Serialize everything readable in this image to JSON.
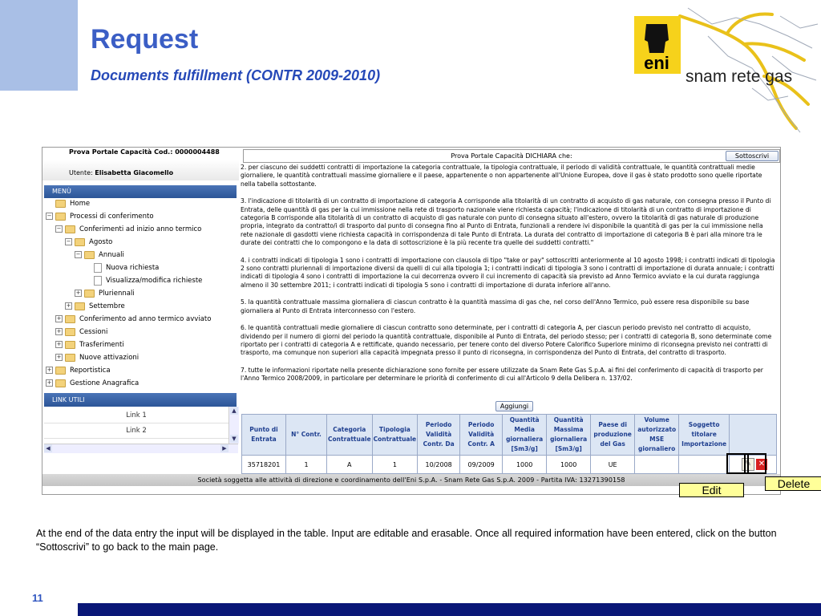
{
  "slide": {
    "title": "Request",
    "subtitle": "Documents fulfillment (CONTR 2009-2010)",
    "page_number": "11",
    "caption": "At the end of the data entry the input will be displayed in the table. Input are editable and erasable. Once all required information have been entered, click on the button “Sottoscrivi” to go back to the main page.",
    "logos": {
      "eni": "eni",
      "snam": "snam rete gas"
    }
  },
  "portal": {
    "code_label": "Prova Portale Capacità Cod.:",
    "code_value": "0000004488",
    "user_label": "Utente:",
    "user_value": "Elisabetta Giacomello",
    "menu_title": "MENÙ",
    "links_title": "LINK UTILI",
    "links": [
      "Link 1",
      "Link 2"
    ],
    "tree": [
      {
        "label": "Home",
        "level": 0,
        "icon": "folder",
        "toggle": ""
      },
      {
        "label": "Processi di conferimento",
        "level": 0,
        "icon": "folder",
        "toggle": "−"
      },
      {
        "label": "Conferimenti ad inizio anno termico",
        "level": 1,
        "icon": "folder",
        "toggle": "−"
      },
      {
        "label": "Agosto",
        "level": 2,
        "icon": "folder",
        "toggle": "−"
      },
      {
        "label": "Annuali",
        "level": 3,
        "icon": "folder",
        "toggle": "−"
      },
      {
        "label": "Nuova richiesta",
        "level": 4,
        "icon": "doc",
        "toggle": ""
      },
      {
        "label": "Visualizza/modifica richieste",
        "level": 4,
        "icon": "doc",
        "toggle": ""
      },
      {
        "label": "Pluriennali",
        "level": 3,
        "icon": "folder",
        "toggle": "+"
      },
      {
        "label": "Settembre",
        "level": 2,
        "icon": "folder",
        "toggle": "+"
      },
      {
        "label": "Conferimento ad anno termico avviato",
        "level": 1,
        "icon": "folder",
        "toggle": "+"
      },
      {
        "label": "Cessioni",
        "level": 1,
        "icon": "folder",
        "toggle": "+"
      },
      {
        "label": "Trasferimenti",
        "level": 1,
        "icon": "folder",
        "toggle": "+"
      },
      {
        "label": "Nuove attivazioni",
        "level": 1,
        "icon": "folder",
        "toggle": "+"
      },
      {
        "label": "Reportistica",
        "level": 0,
        "icon": "folder",
        "toggle": "+"
      },
      {
        "label": "Gestione Anagrafica",
        "level": 0,
        "icon": "folder",
        "toggle": "+"
      }
    ],
    "declaration_title": "Prova Portale Capacità DICHIARA che:",
    "sottoscrivi_label": "Sottoscrivi",
    "declaration_paragraphs": [
      "2. per ciascuno dei suddetti contratti di importazione la categoria contrattuale, la tipologia contrattuale, il periodo di validità contrattuale, le quantità contrattuali medie giornaliere, le quantità contrattuali massime giornaliere e il paese, appartenente o non appartenente all'Unione Europea, dove il gas è stato prodotto sono quelle riportate nella tabella sottostante.",
      "3. l'indicazione di titolarità di un contratto di importazione di categoria A corrisponde alla titolarità di un contratto di acquisto di gas naturale, con consegna presso il Punto di Entrata, delle quantità di gas per la cui immissione nella rete di trasporto nazionale viene richiesta capacità; l'indicazione di titolarità di un contratto di importazione di categoria B corrisponde alla titolarità di un contratto di acquisto di gas naturale con punto di consegna situato all'estero, ovvero la titolarità di gas naturale di produzione propria, integrato da contratto/i di trasporto dal punto di consegna fino al Punto di Entrata, funzionali a rendere ivi disponibile la quantità di gas per la cui immissione nella rete nazionale di gasdotti viene richiesta capacità in corrispondenza di tale Punto di Entrata. La durata del contratto di importazione di categoria B è pari alla minore tra le durate dei contratti che lo compongono e la data di sottoscrizione è la più recente tra quelle dei suddetti contratti.\"",
      "4. i contratti indicati di tipologia 1 sono i contratti di importazione con clausola di tipo \"take or pay\" sottoscritti anteriormente al 10 agosto 1998; i contratti indicati di tipologia 2 sono contratti pluriennali di importazione diversi da quelli di cui alla tipologia 1; i contratti indicati di tipologia 3 sono i contratti di importazione di durata annuale; i contratti indicati di tipologia 4 sono i contratti di importazione la cui decorrenza ovvero il cui incremento di capacità sia previsto ad Anno Termico avviato e la cui durata raggiunga almeno il 30 settembre 2011; i contratti indicati di tipologia 5 sono i contratti di importazione di durata inferiore all'anno.",
      "5. la quantità contrattuale massima giornaliera di ciascun contratto è la quantità massima di gas che, nel corso dell'Anno Termico, può essere resa disponibile su base giornaliera al Punto di Entrata interconnesso con l'estero.",
      "6. le quantità contrattuali medie giornaliere di ciascun contratto sono determinate, per i contratti di categoria A, per ciascun periodo previsto nel contratto di acquisto, dividendo per il numero di giorni del periodo la quantità contrattuale, disponibile al Punto di Entrata, del periodo stesso; per i contratti di categoria B, sono determinate come riportato per i contratti di categoria A e rettificate, quando necessario, per tenere conto del diverso Potere Calorifico Superiore minimo di riconsegna previsto nei contratti di trasporto, ma comunque non superiori alla capacità impegnata presso il punto di riconsegna, in corrispondenza del Punto di Entrata, del contratto di trasporto.",
      "7. tutte le informazioni riportate nella presente dichiarazione sono fornite per essere utilizzate da Snam Rete Gas S.p.A. ai fini del conferimento di capacità di trasporto per l'Anno Termico 2008/2009, in particolare per determinare le priorità di conferimento di cui all'Articolo 9 della Delibera n. 137/02."
    ],
    "aggiungi_label": "Aggiungi",
    "table": {
      "headers": [
        "Punto di Entrata",
        "N° Contr.",
        "Categoria Contrattuale",
        "Tipologia Contrattuale",
        "Periodo Validità Contr. Da",
        "Periodo Validità Contr. A",
        "Quantità Media giornaliera [Sm3/g]",
        "Quantità Massima giornaliera [Sm3/g]",
        "Paese di produzione del Gas",
        "Volume autorizzato MSE giornaliero",
        "Soggetto titolare Importazione",
        ""
      ],
      "rows": [
        [
          "35718201",
          "1",
          "A",
          "1",
          "10/2008",
          "09/2009",
          "1000",
          "1000",
          "UE",
          "",
          ""
        ]
      ]
    },
    "footer_text": "Società soggetta alle attività di direzione e coordinamento dell'Eni S.p.A. - Snam Rete Gas S.p.A. 2009 - Partita IVA: 13271390158"
  },
  "callouts": {
    "edit": "Edit",
    "delete": "Delete"
  },
  "colors": {
    "title": "#3b5ec5",
    "side_bar": "#a9bfe6",
    "bottom_bar": "#0a1777",
    "callout": "#ffff99"
  }
}
